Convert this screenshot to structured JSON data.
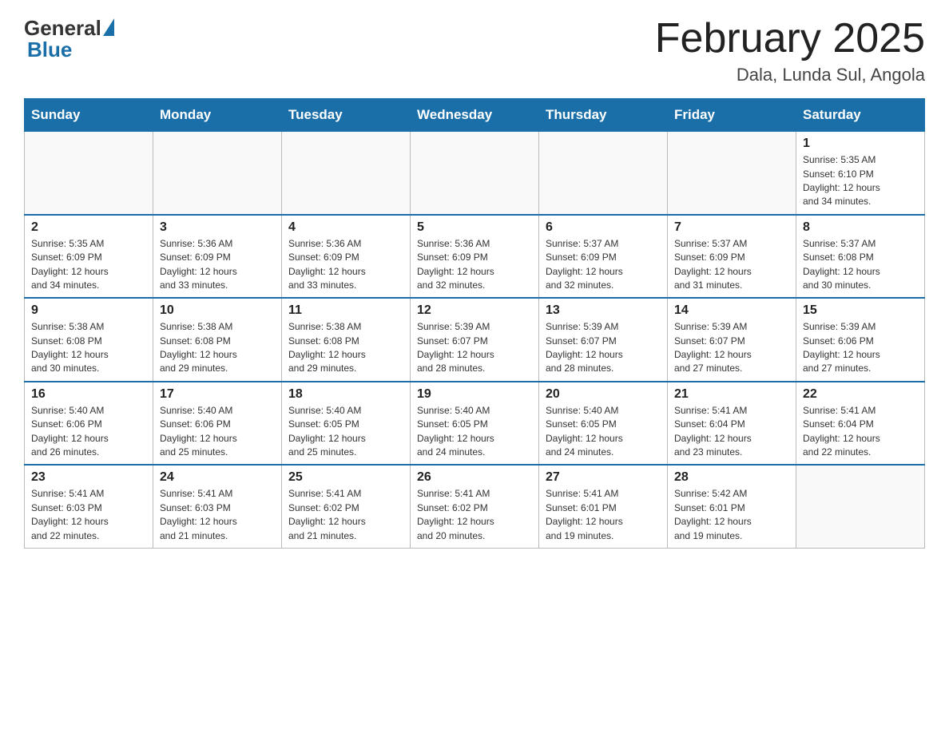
{
  "header": {
    "logo_general": "General",
    "logo_blue": "Blue",
    "title": "February 2025",
    "subtitle": "Dala, Lunda Sul, Angola"
  },
  "weekdays": [
    "Sunday",
    "Monday",
    "Tuesday",
    "Wednesday",
    "Thursday",
    "Friday",
    "Saturday"
  ],
  "weeks": [
    [
      {
        "day": "",
        "info": ""
      },
      {
        "day": "",
        "info": ""
      },
      {
        "day": "",
        "info": ""
      },
      {
        "day": "",
        "info": ""
      },
      {
        "day": "",
        "info": ""
      },
      {
        "day": "",
        "info": ""
      },
      {
        "day": "1",
        "info": "Sunrise: 5:35 AM\nSunset: 6:10 PM\nDaylight: 12 hours\nand 34 minutes."
      }
    ],
    [
      {
        "day": "2",
        "info": "Sunrise: 5:35 AM\nSunset: 6:09 PM\nDaylight: 12 hours\nand 34 minutes."
      },
      {
        "day": "3",
        "info": "Sunrise: 5:36 AM\nSunset: 6:09 PM\nDaylight: 12 hours\nand 33 minutes."
      },
      {
        "day": "4",
        "info": "Sunrise: 5:36 AM\nSunset: 6:09 PM\nDaylight: 12 hours\nand 33 minutes."
      },
      {
        "day": "5",
        "info": "Sunrise: 5:36 AM\nSunset: 6:09 PM\nDaylight: 12 hours\nand 32 minutes."
      },
      {
        "day": "6",
        "info": "Sunrise: 5:37 AM\nSunset: 6:09 PM\nDaylight: 12 hours\nand 32 minutes."
      },
      {
        "day": "7",
        "info": "Sunrise: 5:37 AM\nSunset: 6:09 PM\nDaylight: 12 hours\nand 31 minutes."
      },
      {
        "day": "8",
        "info": "Sunrise: 5:37 AM\nSunset: 6:08 PM\nDaylight: 12 hours\nand 30 minutes."
      }
    ],
    [
      {
        "day": "9",
        "info": "Sunrise: 5:38 AM\nSunset: 6:08 PM\nDaylight: 12 hours\nand 30 minutes."
      },
      {
        "day": "10",
        "info": "Sunrise: 5:38 AM\nSunset: 6:08 PM\nDaylight: 12 hours\nand 29 minutes."
      },
      {
        "day": "11",
        "info": "Sunrise: 5:38 AM\nSunset: 6:08 PM\nDaylight: 12 hours\nand 29 minutes."
      },
      {
        "day": "12",
        "info": "Sunrise: 5:39 AM\nSunset: 6:07 PM\nDaylight: 12 hours\nand 28 minutes."
      },
      {
        "day": "13",
        "info": "Sunrise: 5:39 AM\nSunset: 6:07 PM\nDaylight: 12 hours\nand 28 minutes."
      },
      {
        "day": "14",
        "info": "Sunrise: 5:39 AM\nSunset: 6:07 PM\nDaylight: 12 hours\nand 27 minutes."
      },
      {
        "day": "15",
        "info": "Sunrise: 5:39 AM\nSunset: 6:06 PM\nDaylight: 12 hours\nand 27 minutes."
      }
    ],
    [
      {
        "day": "16",
        "info": "Sunrise: 5:40 AM\nSunset: 6:06 PM\nDaylight: 12 hours\nand 26 minutes."
      },
      {
        "day": "17",
        "info": "Sunrise: 5:40 AM\nSunset: 6:06 PM\nDaylight: 12 hours\nand 25 minutes."
      },
      {
        "day": "18",
        "info": "Sunrise: 5:40 AM\nSunset: 6:05 PM\nDaylight: 12 hours\nand 25 minutes."
      },
      {
        "day": "19",
        "info": "Sunrise: 5:40 AM\nSunset: 6:05 PM\nDaylight: 12 hours\nand 24 minutes."
      },
      {
        "day": "20",
        "info": "Sunrise: 5:40 AM\nSunset: 6:05 PM\nDaylight: 12 hours\nand 24 minutes."
      },
      {
        "day": "21",
        "info": "Sunrise: 5:41 AM\nSunset: 6:04 PM\nDaylight: 12 hours\nand 23 minutes."
      },
      {
        "day": "22",
        "info": "Sunrise: 5:41 AM\nSunset: 6:04 PM\nDaylight: 12 hours\nand 22 minutes."
      }
    ],
    [
      {
        "day": "23",
        "info": "Sunrise: 5:41 AM\nSunset: 6:03 PM\nDaylight: 12 hours\nand 22 minutes."
      },
      {
        "day": "24",
        "info": "Sunrise: 5:41 AM\nSunset: 6:03 PM\nDaylight: 12 hours\nand 21 minutes."
      },
      {
        "day": "25",
        "info": "Sunrise: 5:41 AM\nSunset: 6:02 PM\nDaylight: 12 hours\nand 21 minutes."
      },
      {
        "day": "26",
        "info": "Sunrise: 5:41 AM\nSunset: 6:02 PM\nDaylight: 12 hours\nand 20 minutes."
      },
      {
        "day": "27",
        "info": "Sunrise: 5:41 AM\nSunset: 6:01 PM\nDaylight: 12 hours\nand 19 minutes."
      },
      {
        "day": "28",
        "info": "Sunrise: 5:42 AM\nSunset: 6:01 PM\nDaylight: 12 hours\nand 19 minutes."
      },
      {
        "day": "",
        "info": ""
      }
    ]
  ]
}
